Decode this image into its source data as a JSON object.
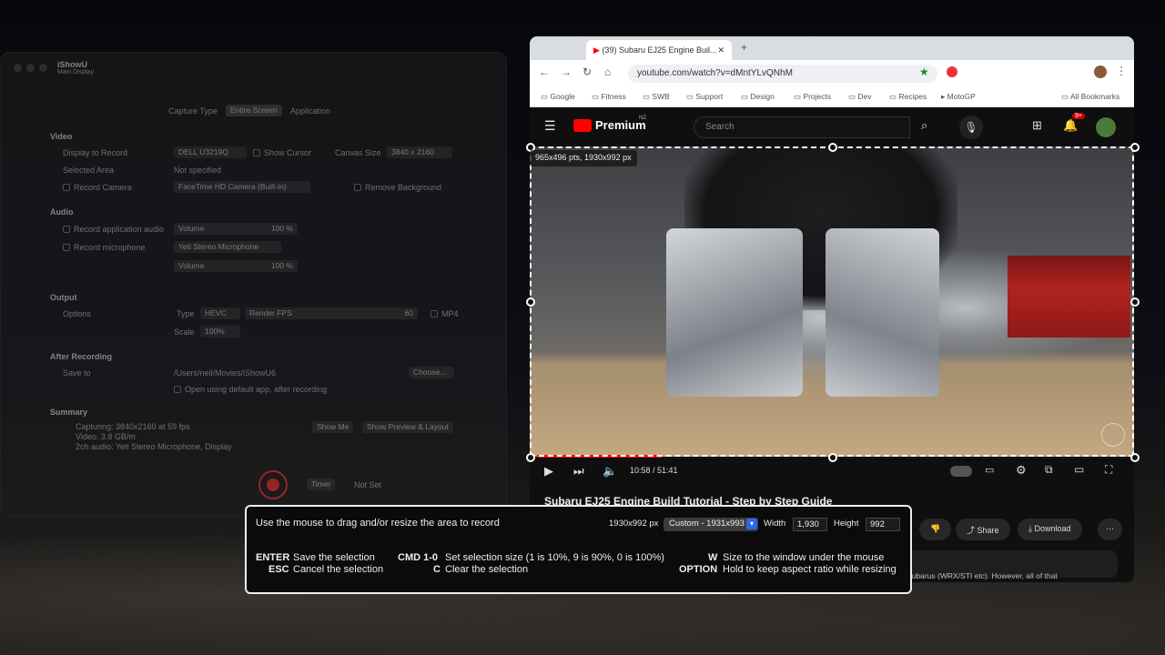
{
  "app": {
    "title": "iShowU",
    "subtitle": "Main Display",
    "capture_type_label": "Capture Type",
    "capture_tabs": [
      "Entire Screen",
      "Application"
    ],
    "video": {
      "heading": "Video",
      "display_label": "Display to Record",
      "display_value": "DELL U3219Q",
      "show_cursor": "Show Cursor",
      "canvas_label": "Canvas Size",
      "canvas_value": "3840 x 2160",
      "selected_area_label": "Selected Area",
      "selected_area_value": "Not specified",
      "record_camera": "Record Camera",
      "camera_value": "FaceTime HD Camera (Built-in)",
      "remove_bg": "Remove Background"
    },
    "audio": {
      "heading": "Audio",
      "record_app_audio": "Record application audio",
      "volume": "Volume",
      "volume_pct": "100 %",
      "record_mic": "Record microphone",
      "mic_value": "Yeti Stereo Microphone",
      "volume2": "Volume",
      "volume2_pct": "100 %"
    },
    "output": {
      "heading": "Output",
      "options": "Options",
      "type_label": "Type",
      "type_value": "HEVC",
      "fps_label": "Render FPS",
      "fps_value": "60",
      "mp4": "MP4",
      "scale_label": "Scale",
      "scale_value": "100%"
    },
    "after": {
      "heading": "After Recording",
      "save_to": "Save to",
      "path": "/Users/neil/Movies/iShowU6",
      "choose": "Choose...",
      "open_default": "Open using default app, after recording"
    },
    "summary": {
      "heading": "Summary",
      "line1": "Capturing: 3840x2160 at 59 fps",
      "line2": "Video: 3.8 GB/m",
      "line3": "2ch audio: Yeti Stereo Microphone, Display",
      "show_me": "Show Me",
      "show_preview": "Show Preview & Layout"
    },
    "timer": "Timer",
    "not_set": "Not Set"
  },
  "browser": {
    "tab_title": "(39) Subaru EJ25 Engine Buil...",
    "url": "youtube.com/watch?v=dMntYLvQNhM",
    "bookmarks": [
      "Google",
      "Fitness",
      "SWB",
      "Support",
      "Design",
      "Projects",
      "Dev",
      "Recipes",
      "MotoGP"
    ],
    "all_bookmarks": "All Bookmarks",
    "yt_logo": "Premium",
    "yt_region": "NZ",
    "search_placeholder": "Search",
    "notif_count": "9+",
    "time": "10:58 / 51:41",
    "video_title": "Subaru EJ25 Engine Build Tutorial - Step by Step Guide",
    "share": "Share",
    "download": "Download",
    "desc_snippet": "nel for Subarus (WRX/STI etc). However, all of that"
  },
  "selection": {
    "size_badge": "965x496 pts, 1930x992 px"
  },
  "panel": {
    "instruction": "Use the mouse to drag and/or resize the area to record",
    "px_size": "1930x992 px",
    "preset": "Custom - 1931x993",
    "width_label": "Width",
    "width_value": "1,930",
    "height_label": "Height",
    "height_value": "992",
    "enter_key": "ENTER",
    "enter_desc": "Save the selection",
    "esc_key": "ESC",
    "esc_desc": "Cancel the selection",
    "cmd_key": "CMD 1-0",
    "cmd_desc": "Set selection size (1 is 10%, 9 is 90%, 0 is 100%)",
    "c_key": "C",
    "c_desc": "Clear the selection",
    "w_key": "W",
    "w_desc": "Size to the window under the mouse",
    "opt_key": "OPTION",
    "opt_desc": "Hold to keep aspect ratio while resizing"
  }
}
